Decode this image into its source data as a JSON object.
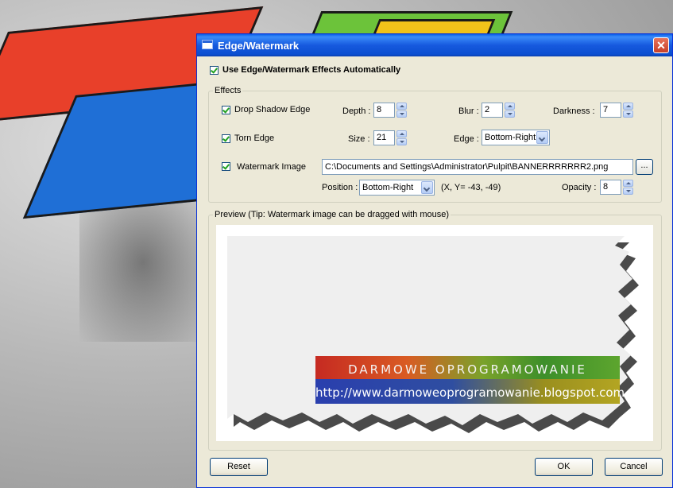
{
  "window": {
    "title": "Edge/Watermark"
  },
  "auto_effects": {
    "label": "Use Edge/Watermark Effects Automatically",
    "checked": true
  },
  "effects": {
    "legend": "Effects",
    "drop_shadow": {
      "label": "Drop Shadow Edge",
      "checked": true,
      "depth_label": "Depth :",
      "depth": "8",
      "blur_label": "Blur :",
      "blur": "2",
      "darkness_label": "Darkness :",
      "darkness": "7"
    },
    "torn_edge": {
      "label": "Torn Edge",
      "checked": true,
      "size_label": "Size :",
      "size": "21",
      "edge_label": "Edge :",
      "edge": "Bottom-Right"
    },
    "watermark": {
      "label": "Watermark Image",
      "checked": true,
      "path": "C:\\Documents and Settings\\Administrator\\Pulpit\\BANNERRRRRRR2.png",
      "browse_label": "...",
      "position_label": "Position :",
      "position": "Bottom-Right",
      "coords": "(X, Y= -43, -49)",
      "opacity_label": "Opacity :",
      "opacity": "8"
    }
  },
  "preview": {
    "legend": "Preview (Tip: Watermark image can be dragged with mouse)",
    "banner_title": "DARMOWE OPROGRAMOWANIE",
    "banner_url": "http://www.darmoweoprogramowanie.blogspot.com"
  },
  "buttons": {
    "reset": "Reset",
    "ok": "OK",
    "cancel": "Cancel"
  },
  "colors": {
    "titlebar": "#0c4fd1",
    "dialog_bg": "#ece9d8",
    "check": "#21a121"
  }
}
